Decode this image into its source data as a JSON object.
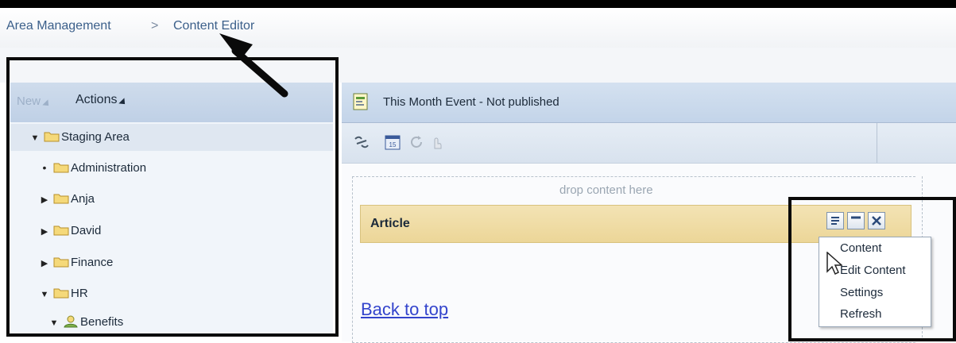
{
  "breadcrumb": {
    "item1": "Area Management",
    "separator": ">",
    "item2": "Content Editor"
  },
  "left_toolbar": {
    "new_label": "New",
    "actions_label": "Actions"
  },
  "tree": [
    {
      "label": "Staging Area",
      "state": "expanded",
      "icon": "folder-icon"
    },
    {
      "label": "Administration",
      "state": "leaf",
      "icon": "folder-icon"
    },
    {
      "label": "Anja",
      "state": "collapsed",
      "icon": "folder-icon"
    },
    {
      "label": "David",
      "state": "collapsed",
      "icon": "folder-icon"
    },
    {
      "label": "Finance",
      "state": "collapsed",
      "icon": "folder-icon"
    },
    {
      "label": "HR",
      "state": "expanded",
      "icon": "folder-icon"
    },
    {
      "label": "Benefits",
      "state": "expanded",
      "icon": "group-icon"
    }
  ],
  "editor": {
    "title": "This Month Event - Not published",
    "drop_text": "drop content here",
    "article_title": "Article",
    "back_link": "Back to top"
  },
  "context_menu": {
    "items": [
      "Content",
      "Edit Content",
      "Settings",
      "Refresh"
    ]
  },
  "colors": {
    "folder": "#f5d97a",
    "accent": "#3b5f8a",
    "article_header": "#ecd698",
    "link": "#3344cc"
  }
}
